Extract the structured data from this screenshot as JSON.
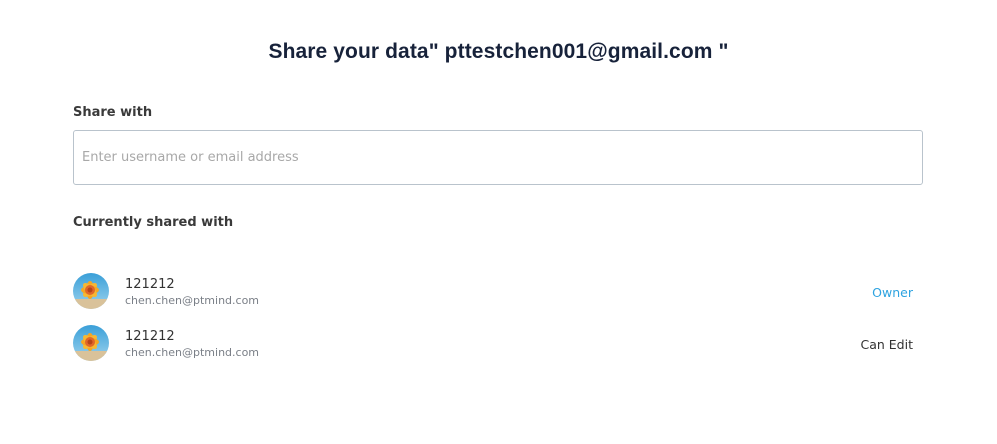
{
  "dialog": {
    "title": "Share your data\" pttestchen001@gmail.com \""
  },
  "share": {
    "label": "Share with",
    "placeholder": "Enter username or email address",
    "value": ""
  },
  "current": {
    "label": "Currently shared with",
    "users": [
      {
        "name": "121212",
        "email": "chen.chen@ptmind.com",
        "role": "Owner",
        "avatar_icon": "sunflower-avatar-icon"
      },
      {
        "name": "121212",
        "email": "chen.chen@ptmind.com",
        "role": "Can Edit",
        "avatar_icon": "sunflower-avatar-icon"
      }
    ]
  },
  "colors": {
    "title": "#17223a",
    "owner_role": "#2ea3e0",
    "input_border": "#b9c3cc",
    "email_text": "#7a7f87"
  }
}
